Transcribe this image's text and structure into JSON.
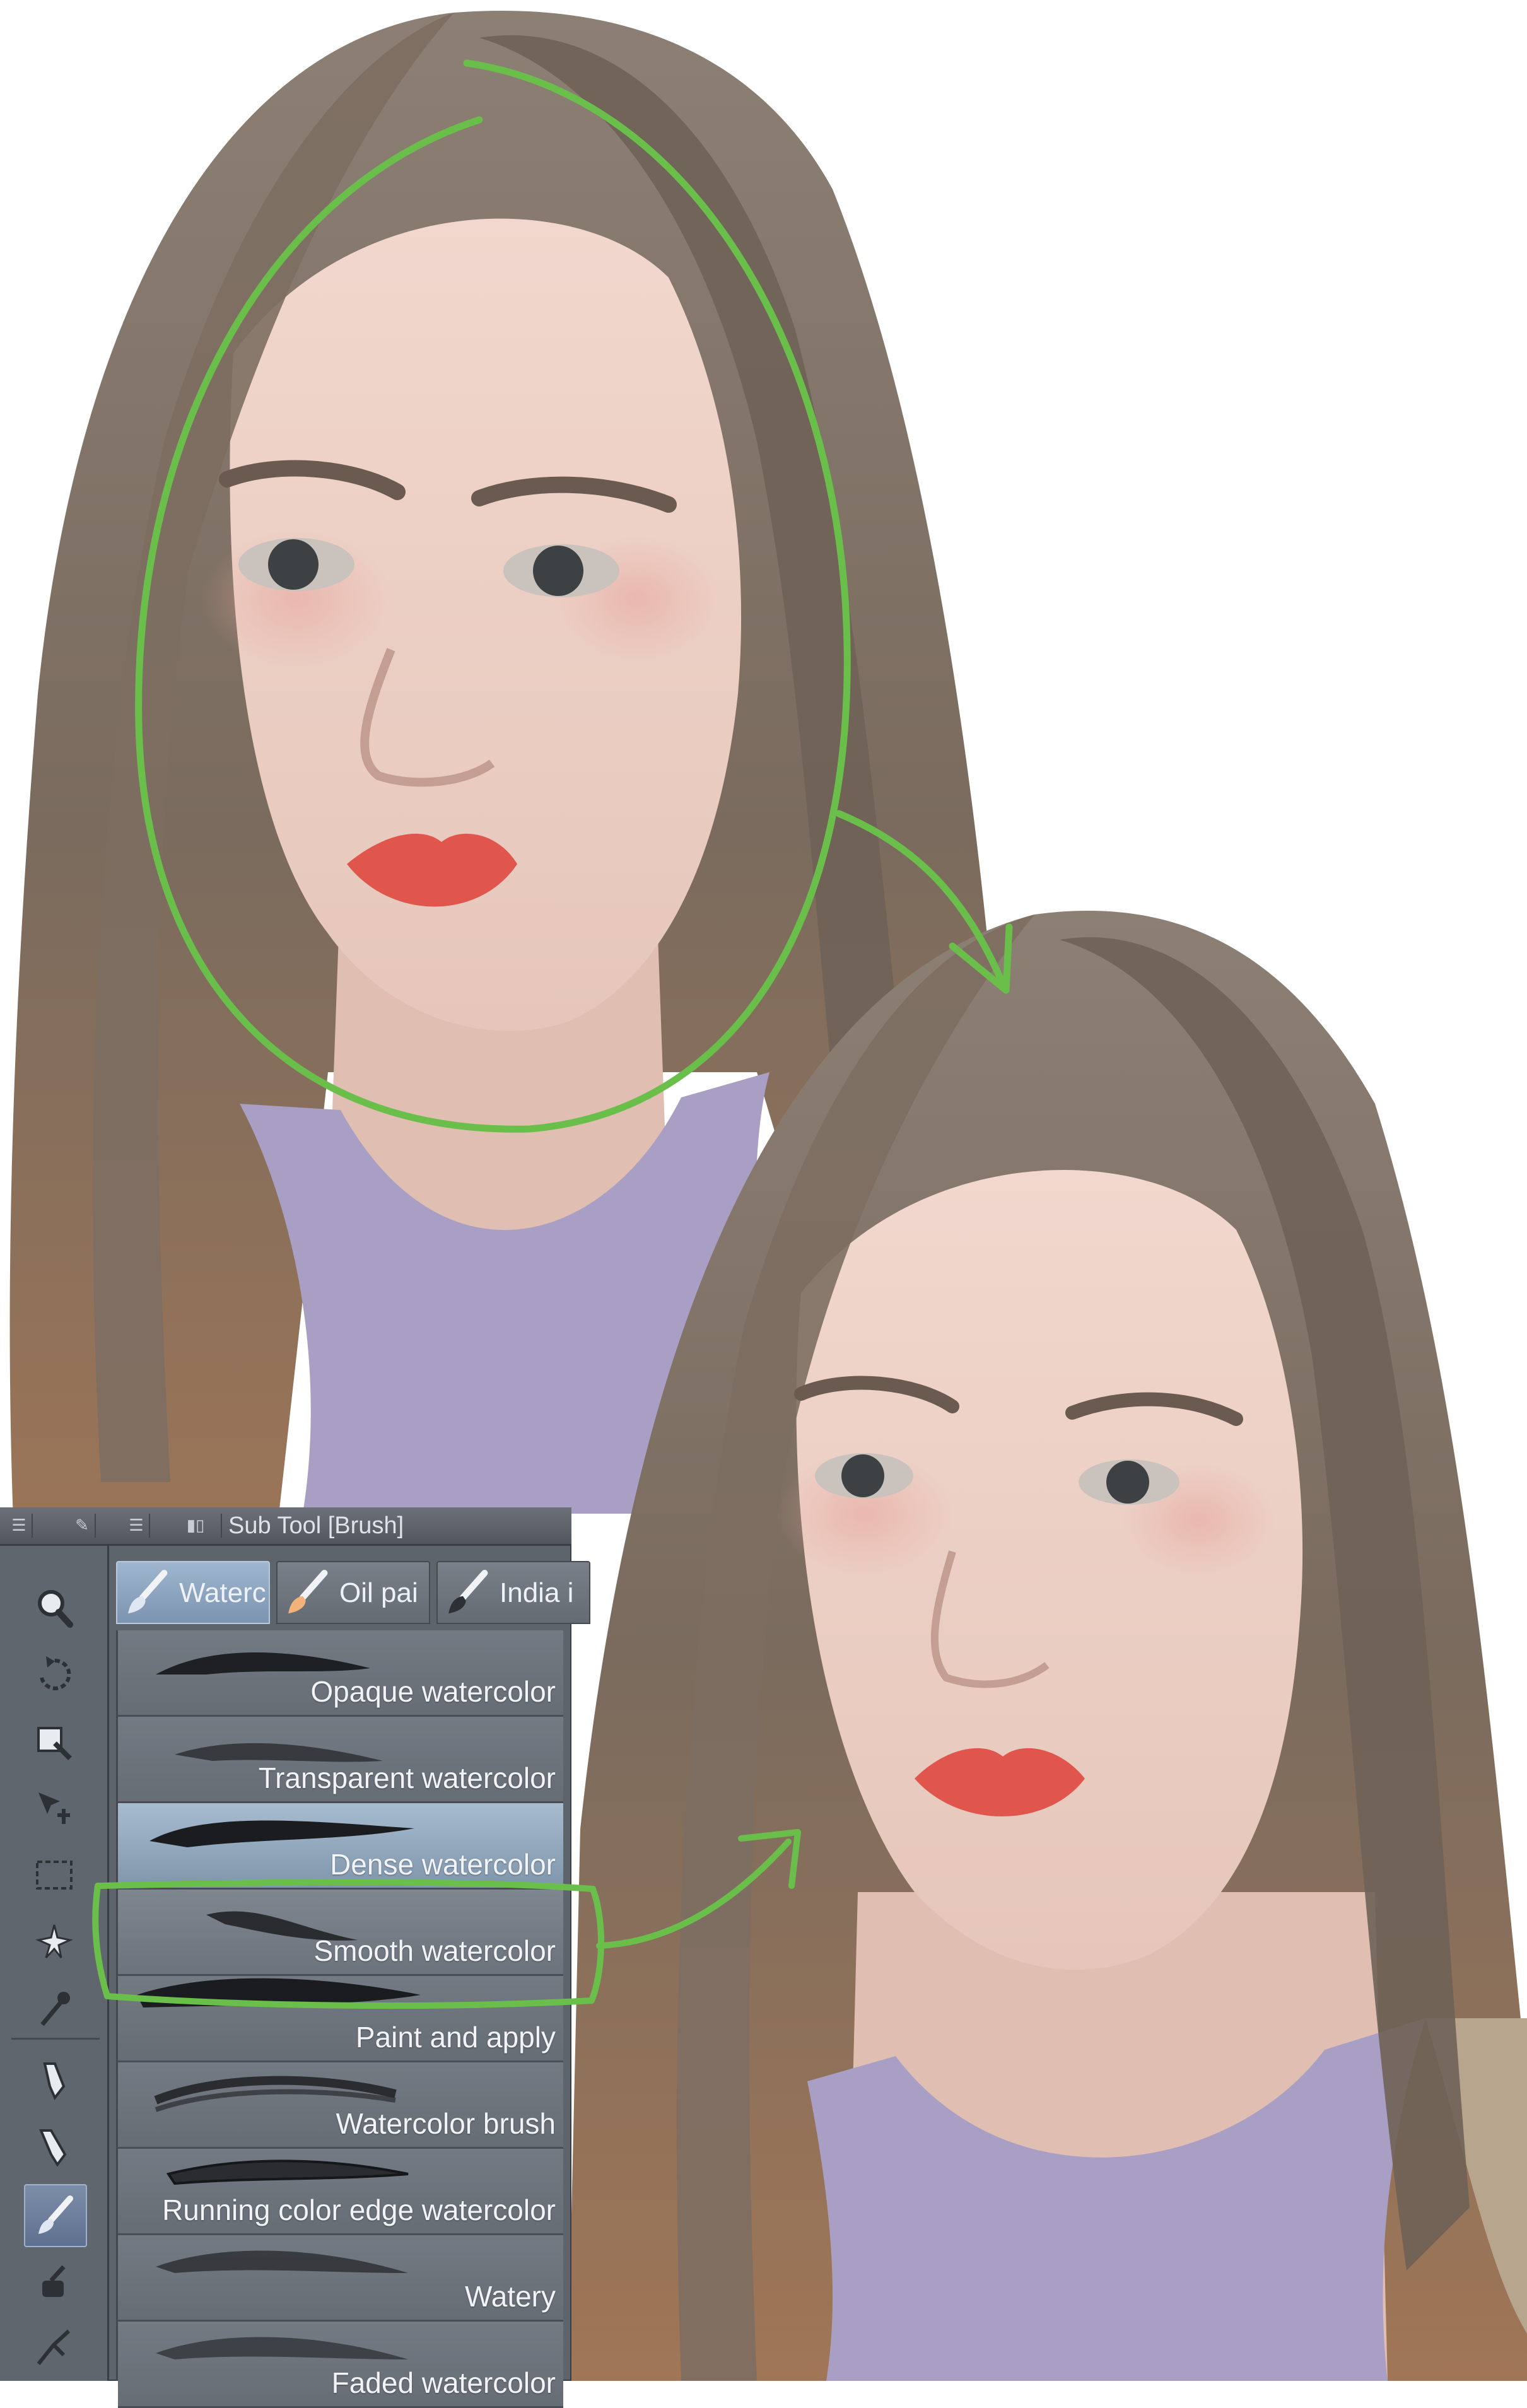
{
  "panel": {
    "title": "Sub Tool [Brush]",
    "tabs": [
      {
        "label": "Waterc",
        "icon": "watercolor-brush-icon",
        "active": true
      },
      {
        "label": "Oil pai",
        "icon": "oil-paint-brush-icon",
        "active": false
      },
      {
        "label": "India i",
        "icon": "india-ink-brush-icon",
        "active": false
      }
    ],
    "tools": [
      {
        "icon": "zoom-icon"
      },
      {
        "icon": "rotate-icon"
      },
      {
        "icon": "operation-icon"
      },
      {
        "icon": "move-layer-icon"
      },
      {
        "icon": "selection-icon"
      },
      {
        "icon": "auto-select-icon"
      },
      {
        "icon": "eyedropper-icon"
      },
      {
        "icon": "pen-icon"
      },
      {
        "icon": "pencil-icon"
      },
      {
        "icon": "brush-icon",
        "active": true
      },
      {
        "icon": "airbrush-icon"
      },
      {
        "icon": "decoration-icon"
      }
    ],
    "brushes": [
      {
        "name": "Opaque watercolor",
        "state": "normal"
      },
      {
        "name": "Transparent watercolor",
        "state": "normal"
      },
      {
        "name": "Dense watercolor",
        "state": "selected"
      },
      {
        "name": "Smooth watercolor",
        "state": "hover"
      },
      {
        "name": "Paint and apply",
        "state": "normal"
      },
      {
        "name": "Watercolor brush",
        "state": "normal"
      },
      {
        "name": "Running color edge watercolor",
        "state": "normal"
      },
      {
        "name": "Watery",
        "state": "normal"
      },
      {
        "name": "Faded watercolor",
        "state": "normal"
      }
    ]
  },
  "colors": {
    "annotation": "#6abf4b",
    "hair": "#6f6257",
    "skin": "#ecd0c6",
    "lips": "#e0554c",
    "sweater": "#a99fc4"
  }
}
